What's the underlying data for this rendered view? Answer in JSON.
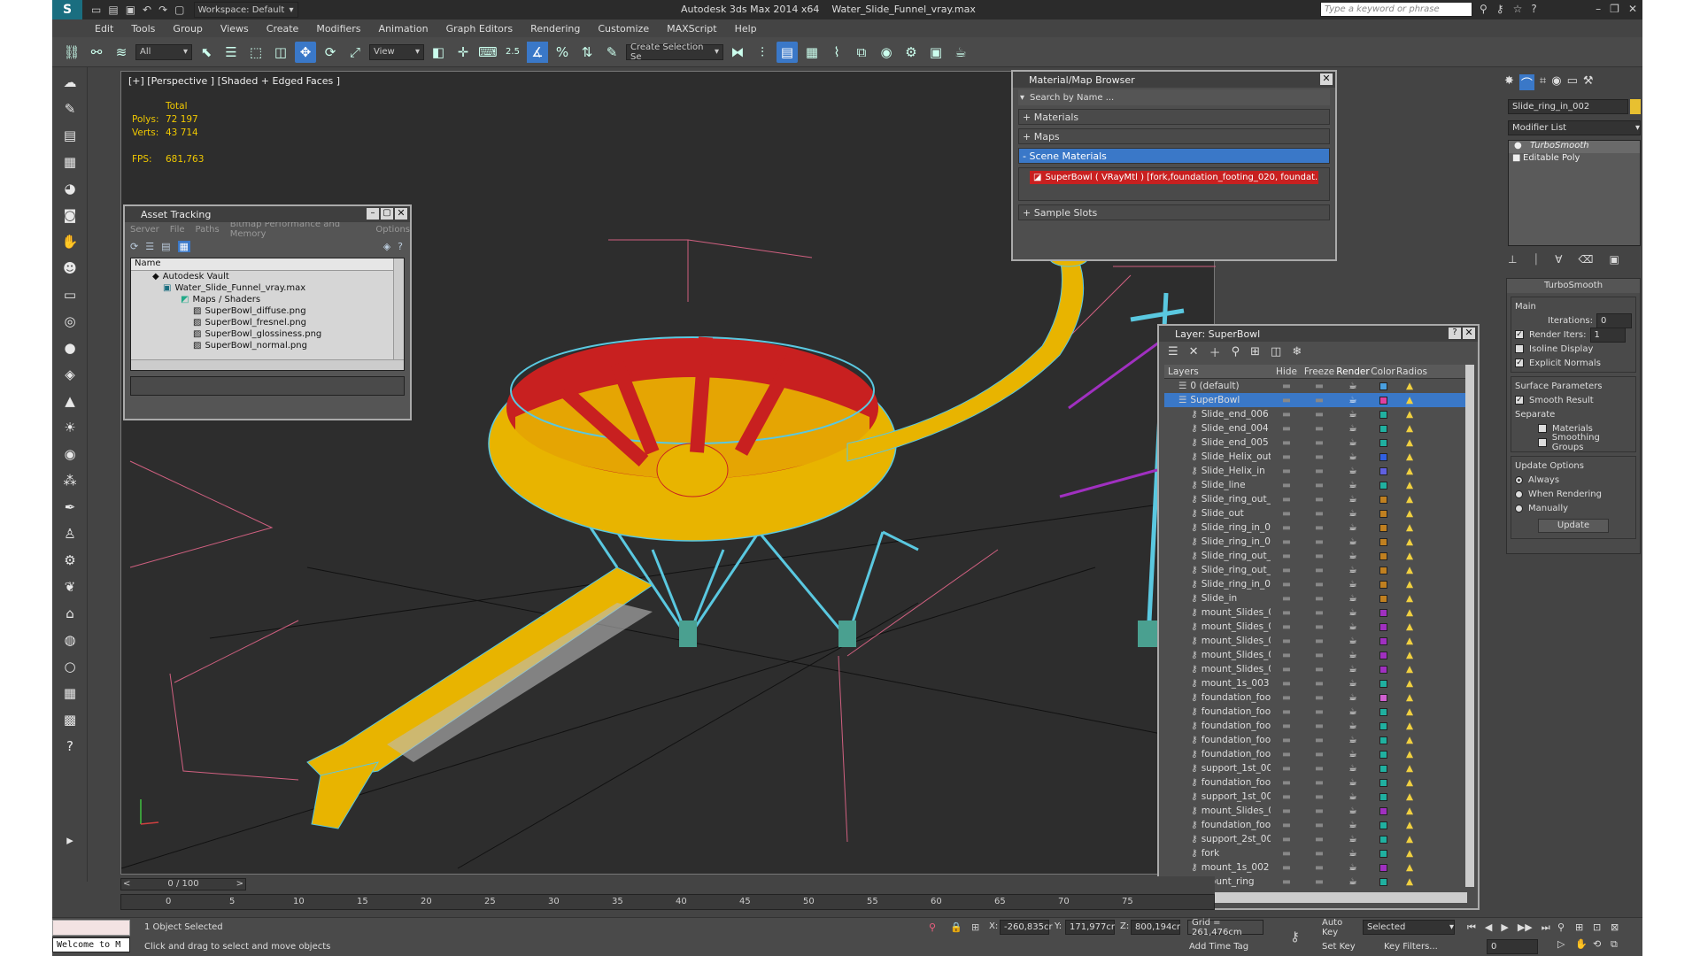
{
  "title": {
    "workspace": "Workspace: Default",
    "app": "Autodesk 3ds Max  2014 x64",
    "file": "Water_Slide_Funnel_vray.max",
    "search_placeholder": "Type a keyword or phrase"
  },
  "menu": [
    "Edit",
    "Tools",
    "Group",
    "Views",
    "Create",
    "Modifiers",
    "Animation",
    "Graph Editors",
    "Rendering",
    "Customize",
    "MAXScript",
    "Help"
  ],
  "toolbar": {
    "selection_filter": "All",
    "ref_coord": "View",
    "named_selection": "Create Selection Se",
    "snap_label": "2.5"
  },
  "viewport": {
    "label": "[+] [Perspective ] [Shaded + Edged Faces ]",
    "stats": {
      "total_label": "Total",
      "polys_label": "Polys:",
      "polys": "72 197",
      "verts_label": "Verts:",
      "verts": "43 714",
      "fps_label": "FPS:",
      "fps": "681,763"
    }
  },
  "asset_tracking": {
    "title": "Asset Tracking",
    "menu": [
      "Server",
      "File",
      "Paths",
      "Bitmap Performance and Memory",
      "Options"
    ],
    "column": "Name",
    "rows": [
      "Autodesk Vault",
      "Water_Slide_Funnel_vray.max",
      "Maps / Shaders",
      "SuperBowl_diffuse.png",
      "SuperBowl_fresnel.png",
      "SuperBowl_glossiness.png",
      "SuperBowl_normal.png"
    ]
  },
  "material_browser": {
    "title": "Material/Map Browser",
    "search_placeholder": "Search by Name ...",
    "sections": [
      "+ Materials",
      "+ Maps",
      "- Scene Materials",
      "+ Sample Slots"
    ],
    "scene_material": "SuperBowl  ( VRayMtl ) [fork,foundation_footing_020, foundat..."
  },
  "layer_explorer": {
    "title": "Layer: SuperBowl",
    "columns": [
      "Layers",
      "Hide",
      "Freeze",
      "Render",
      "Color",
      "Radios"
    ],
    "layers": [
      {
        "name": "0 (default)",
        "color": "#4aa0e0"
      },
      {
        "name": "SuperBowl",
        "color": "#e040a0"
      },
      {
        "name": "Slide_end_006",
        "color": "#20b0a0"
      },
      {
        "name": "Slide_end_004",
        "color": "#20b0a0"
      },
      {
        "name": "Slide_end_005",
        "color": "#20b0a0"
      },
      {
        "name": "Slide_Helix_out",
        "color": "#3060e0"
      },
      {
        "name": "Slide_Helix_in",
        "color": "#6060e0"
      },
      {
        "name": "Slide_line",
        "color": "#20b0a0"
      },
      {
        "name": "Slide_ring_out_0",
        "color": "#c08020"
      },
      {
        "name": "Slide_out",
        "color": "#c08020"
      },
      {
        "name": "Slide_ring_in_00",
        "color": "#c08020"
      },
      {
        "name": "Slide_ring_in_00",
        "color": "#c08020"
      },
      {
        "name": "Slide_ring_out_0",
        "color": "#c08020"
      },
      {
        "name": "Slide_ring_out_0",
        "color": "#c08020"
      },
      {
        "name": "Slide_ring_in_00",
        "color": "#c08020"
      },
      {
        "name": "Slide_in",
        "color": "#c08020"
      },
      {
        "name": "mount_Slides_01",
        "color": "#a030c0"
      },
      {
        "name": "mount_Slides_01",
        "color": "#a030c0"
      },
      {
        "name": "mount_Slides_01",
        "color": "#a030c0"
      },
      {
        "name": "mount_Slides_01",
        "color": "#a030c0"
      },
      {
        "name": "mount_Slides_0C",
        "color": "#a030c0"
      },
      {
        "name": "mount_1s_003",
        "color": "#20b0a0"
      },
      {
        "name": "foundation_footi",
        "color": "#d060d0"
      },
      {
        "name": "foundation_footi",
        "color": "#20b0a0"
      },
      {
        "name": "foundation_footi",
        "color": "#20b0a0"
      },
      {
        "name": "foundation_footi",
        "color": "#20b0a0"
      },
      {
        "name": "foundation_footi",
        "color": "#20b0a0"
      },
      {
        "name": "support_1st_00€",
        "color": "#20b0a0"
      },
      {
        "name": "foundation_footi",
        "color": "#20b0a0"
      },
      {
        "name": "support_1st_001",
        "color": "#20b0a0"
      },
      {
        "name": "mount_Slides_0C",
        "color": "#a030c0"
      },
      {
        "name": "foundation_footi",
        "color": "#20b0a0"
      },
      {
        "name": "support_2st_001",
        "color": "#20b0a0"
      },
      {
        "name": "fork",
        "color": "#20b0a0"
      },
      {
        "name": "mount_1s_002",
        "color": "#a030c0"
      },
      {
        "name": "mount_ring",
        "color": "#20b0a0"
      }
    ]
  },
  "command_panel": {
    "object_name": "Slide_ring_in_002",
    "modifier_list": "Modifier List",
    "stack": [
      "TurboSmooth",
      "Editable Poly"
    ],
    "rollout_title": "TurboSmooth",
    "main_label": "Main",
    "iterations_label": "Iterations:",
    "iterations": "0",
    "render_iters_label": "Render Iters:",
    "render_iters": "1",
    "isoline": "Isoline Display",
    "explicit_normals": "Explicit Normals",
    "surface_params": "Surface Parameters",
    "smooth_result": "Smooth Result",
    "separate": "Separate",
    "materials": "Materials",
    "smoothing_groups": "Smoothing Groups",
    "update_options": "Update Options",
    "always": "Always",
    "when_rendering": "When Rendering",
    "manually": "Manually",
    "update_button": "Update"
  },
  "timeline": {
    "frame": "0 / 100",
    "ticks": [
      "0",
      "5",
      "10",
      "15",
      "20",
      "25",
      "30",
      "35",
      "40",
      "45",
      "50",
      "55",
      "60",
      "65",
      "70",
      "75"
    ]
  },
  "status": {
    "maxscript": "Welcome to M",
    "selected": "1 Object Selected",
    "prompt": "Click and drag to select and move objects",
    "x_label": "X:",
    "x": "-260,835cr",
    "y_label": "Y:",
    "y": "171,977cr",
    "z_label": "Z:",
    "z": "800,194cr",
    "grid": "Grid = 261,476cm",
    "auto_key": "Auto Key",
    "selected_combo": "Selected",
    "set_key": "Set Key",
    "key_filters": "Key Filters...",
    "add_time_tag": "Add Time Tag",
    "frame_field": "0"
  },
  "colors": {
    "accent": "#3a78c8",
    "stats_yellow": "#f0c800",
    "bowl_yellow": "#e8b400",
    "bowl_red": "#c82020",
    "wire_cyan": "#5ac8e0"
  }
}
